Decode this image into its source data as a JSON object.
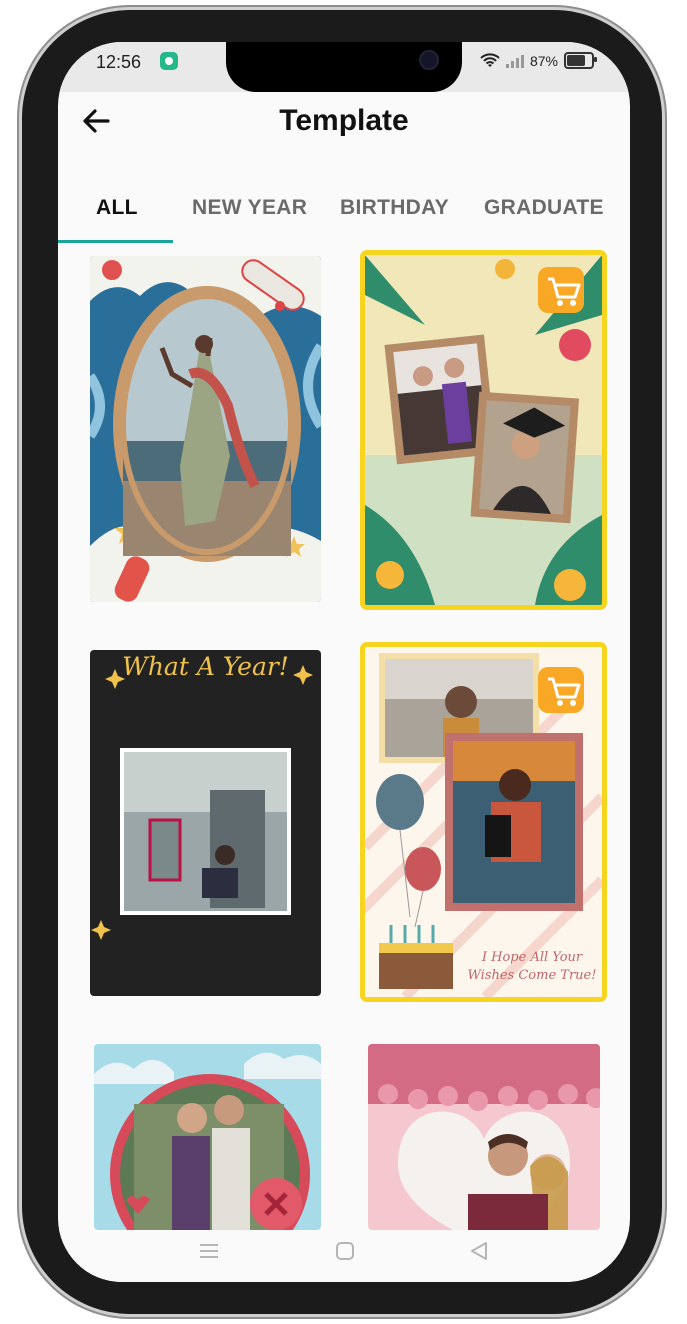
{
  "status": {
    "time": "12:56",
    "battery": "87%"
  },
  "header": {
    "title": "Template"
  },
  "tabs": [
    {
      "label": "ALL",
      "active": true
    },
    {
      "label": "NEW YEAR",
      "active": false
    },
    {
      "label": "BIRTHDAY",
      "active": false
    },
    {
      "label": "GRADUATE",
      "active": false
    }
  ],
  "cards": [
    {
      "id": "beach-oval",
      "premium": false
    },
    {
      "id": "graduation",
      "premium": true
    },
    {
      "id": "what-a-year",
      "premium": false,
      "text": "What A Year!"
    },
    {
      "id": "birthday-wishes",
      "premium": true,
      "text_line1": "I Hope All Your",
      "text_line2": "Wishes Come True!"
    },
    {
      "id": "couple-round",
      "premium": false
    },
    {
      "id": "heart-couple",
      "premium": false
    }
  ],
  "colors": {
    "accent": "#1aa39a",
    "premium_border": "#f7d51f",
    "cart_badge": "#f9a825"
  }
}
